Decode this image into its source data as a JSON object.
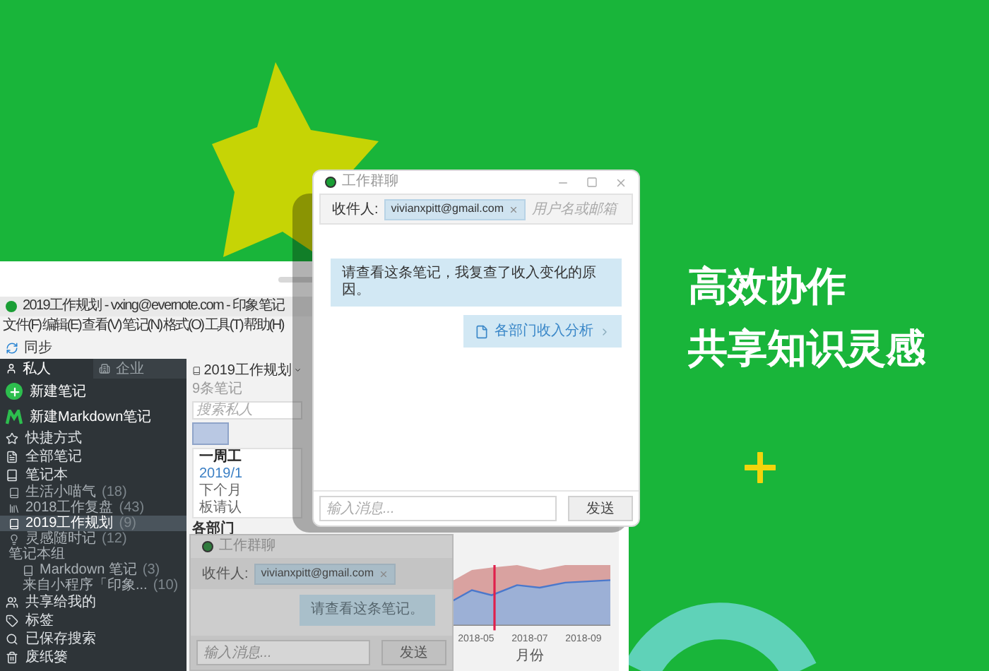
{
  "headline": [
    "高效协作",
    "共享知识灵感"
  ],
  "app_window": {
    "title": "2019工作规划 - vxing@evernote.com - 印象笔记",
    "menu": [
      "文件(F)",
      "编辑(E)",
      "查看(V)",
      "笔记(N)",
      "格式(O)",
      "工具(T)",
      "帮助(H)"
    ],
    "toolbar": [
      {
        "label": "同步"
      }
    ],
    "sidebar": {
      "tabs": [
        {
          "label": "私人",
          "selected": true
        },
        {
          "label": "企业",
          "selected": false
        }
      ],
      "actions": [
        {
          "label": "新建笔记",
          "kind": "note"
        },
        {
          "label": "新建Markdown笔记",
          "kind": "markdown"
        }
      ],
      "items": [
        {
          "label": "快捷方式",
          "kind": "star"
        },
        {
          "label": "全部笔记",
          "kind": "notes"
        },
        {
          "label": "笔记本",
          "kind": "notebook",
          "children": [
            {
              "label": "生活小喵气",
              "count": "(18)",
              "kind": "notebook",
              "selected": false
            },
            {
              "label": "2018工作复盘",
              "count": "(43)",
              "kind": "stack",
              "selected": false
            },
            {
              "label": "2019工作规划",
              "count": "(9)",
              "kind": "notebook",
              "selected": true
            },
            {
              "label": "灵感随时记",
              "count": "(12)",
              "kind": "idea",
              "selected": false
            },
            {
              "label": "笔记本组",
              "kind": "group",
              "selected": false,
              "children": [
                {
                  "label": "Markdown 笔记",
                  "count": "(3)",
                  "kind": "markdown",
                  "selected": false
                },
                {
                  "label": "来自小程序「印象...",
                  "count": "(10)",
                  "kind": "plain",
                  "selected": false
                }
              ]
            }
          ]
        },
        {
          "label": "共享给我的",
          "kind": "shared"
        },
        {
          "label": "标签",
          "kind": "tag"
        },
        {
          "label": "已保存搜索",
          "kind": "search"
        },
        {
          "label": "废纸篓",
          "kind": "trash"
        }
      ]
    },
    "note_list": {
      "title": "2019工作规划",
      "count": "9条笔记",
      "search_placeholder": "搜索私人",
      "entries": [
        {
          "kind": "title",
          "text": "一周工"
        },
        {
          "kind": "date",
          "text": "2019/1"
        },
        {
          "kind": "body",
          "text": "下个月"
        },
        {
          "kind": "body",
          "text": "板请认"
        }
      ],
      "section": "各部门"
    },
    "chart": {
      "x_labels": [
        "2018-05",
        "2018-07",
        "2018-09"
      ],
      "xlabel": "月份"
    }
  },
  "chat_back": {
    "title": "工作群聊",
    "recipient_label": "收件人:",
    "recipient": "vivianxpitt@gmail.com",
    "messages": [
      {
        "kind": "text",
        "text": "请查看这条笔记。"
      }
    ],
    "input_placeholder": "输入消息...",
    "send": "发送"
  },
  "chat_front": {
    "title": "工作群聊",
    "recipient_label": "收件人:",
    "recipient": "vivianxpitt@gmail.com",
    "recipient_placeholder": "用户名或邮箱",
    "messages": [
      {
        "kind": "text",
        "text": "请查看这条笔记，我复查了收入变化的原因。"
      },
      {
        "kind": "note",
        "text": "各部门收入分析"
      }
    ],
    "input_placeholder": "输入消息...",
    "send": "发送"
  }
}
